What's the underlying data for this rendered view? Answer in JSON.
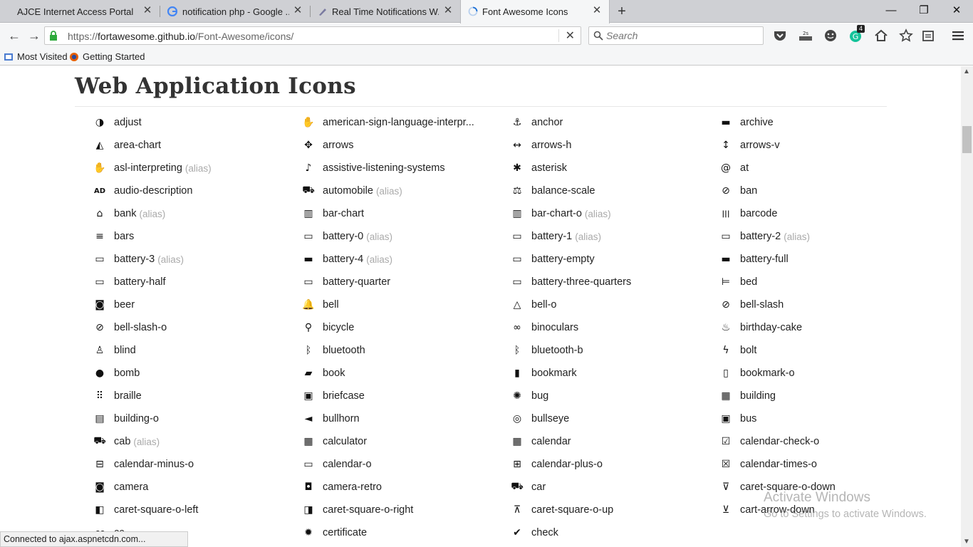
{
  "browser": {
    "tabs": [
      {
        "title": "AJCE Internet Access Portal",
        "active": false
      },
      {
        "title": "notification php - Google ...",
        "active": false
      },
      {
        "title": "Real Time Notifications W...",
        "active": false
      },
      {
        "title": "Font Awesome Icons",
        "active": true
      }
    ],
    "url_domain": "fortawesome.github.io",
    "url_prefix": "https://",
    "url_path": "/Font-Awesome/icons/",
    "search_placeholder": "Search",
    "bookmarks": [
      "Most Visited",
      "Getting Started"
    ],
    "badge_count": "4",
    "badge_small": "2s"
  },
  "page": {
    "title": "Web Application Icons",
    "alias_label": "(alias)",
    "icons": [
      {
        "name": "adjust",
        "glyph": "◑"
      },
      {
        "name": "american-sign-language-interpr...",
        "glyph": "✋"
      },
      {
        "name": "anchor",
        "glyph": "⚓"
      },
      {
        "name": "archive",
        "glyph": "▬"
      },
      {
        "name": "area-chart",
        "glyph": "◭"
      },
      {
        "name": "arrows",
        "glyph": "✥"
      },
      {
        "name": "arrows-h",
        "glyph": "↔"
      },
      {
        "name": "arrows-v",
        "glyph": "↕"
      },
      {
        "name": "asl-interpreting",
        "glyph": "✋",
        "alias": true
      },
      {
        "name": "assistive-listening-systems",
        "glyph": "♪"
      },
      {
        "name": "asterisk",
        "glyph": "✱"
      },
      {
        "name": "at",
        "glyph": "@"
      },
      {
        "name": "audio-description",
        "glyph": "AD"
      },
      {
        "name": "automobile",
        "glyph": "⛟",
        "alias": true
      },
      {
        "name": "balance-scale",
        "glyph": "⚖"
      },
      {
        "name": "ban",
        "glyph": "⊘"
      },
      {
        "name": "bank",
        "glyph": "⌂",
        "alias": true
      },
      {
        "name": "bar-chart",
        "glyph": "▥"
      },
      {
        "name": "bar-chart-o",
        "glyph": "▥",
        "alias": true
      },
      {
        "name": "barcode",
        "glyph": "|||"
      },
      {
        "name": "bars",
        "glyph": "≡"
      },
      {
        "name": "battery-0",
        "glyph": "▭",
        "alias": true
      },
      {
        "name": "battery-1",
        "glyph": "▭",
        "alias": true
      },
      {
        "name": "battery-2",
        "glyph": "▭",
        "alias": true
      },
      {
        "name": "battery-3",
        "glyph": "▭",
        "alias": true
      },
      {
        "name": "battery-4",
        "glyph": "▬",
        "alias": true
      },
      {
        "name": "battery-empty",
        "glyph": "▭"
      },
      {
        "name": "battery-full",
        "glyph": "▬"
      },
      {
        "name": "battery-half",
        "glyph": "▭"
      },
      {
        "name": "battery-quarter",
        "glyph": "▭"
      },
      {
        "name": "battery-three-quarters",
        "glyph": "▭"
      },
      {
        "name": "bed",
        "glyph": "⊨"
      },
      {
        "name": "beer",
        "glyph": "◙"
      },
      {
        "name": "bell",
        "glyph": "🔔"
      },
      {
        "name": "bell-o",
        "glyph": "△"
      },
      {
        "name": "bell-slash",
        "glyph": "⊘"
      },
      {
        "name": "bell-slash-o",
        "glyph": "⊘"
      },
      {
        "name": "bicycle",
        "glyph": "⚲"
      },
      {
        "name": "binoculars",
        "glyph": "∞"
      },
      {
        "name": "birthday-cake",
        "glyph": "♨"
      },
      {
        "name": "blind",
        "glyph": "♙"
      },
      {
        "name": "bluetooth",
        "glyph": "ᛒ"
      },
      {
        "name": "bluetooth-b",
        "glyph": "ᛒ"
      },
      {
        "name": "bolt",
        "glyph": "ϟ"
      },
      {
        "name": "bomb",
        "glyph": "●"
      },
      {
        "name": "book",
        "glyph": "▰"
      },
      {
        "name": "bookmark",
        "glyph": "▮"
      },
      {
        "name": "bookmark-o",
        "glyph": "▯"
      },
      {
        "name": "braille",
        "glyph": "⠿"
      },
      {
        "name": "briefcase",
        "glyph": "▣"
      },
      {
        "name": "bug",
        "glyph": "✺"
      },
      {
        "name": "building",
        "glyph": "▦"
      },
      {
        "name": "building-o",
        "glyph": "▤"
      },
      {
        "name": "bullhorn",
        "glyph": "◄"
      },
      {
        "name": "bullseye",
        "glyph": "◎"
      },
      {
        "name": "bus",
        "glyph": "▣"
      },
      {
        "name": "cab",
        "glyph": "⛟",
        "alias": true
      },
      {
        "name": "calculator",
        "glyph": "▦"
      },
      {
        "name": "calendar",
        "glyph": "▦"
      },
      {
        "name": "calendar-check-o",
        "glyph": "☑"
      },
      {
        "name": "calendar-minus-o",
        "glyph": "⊟"
      },
      {
        "name": "calendar-o",
        "glyph": "▭"
      },
      {
        "name": "calendar-plus-o",
        "glyph": "⊞"
      },
      {
        "name": "calendar-times-o",
        "glyph": "☒"
      },
      {
        "name": "camera",
        "glyph": "◙"
      },
      {
        "name": "camera-retro",
        "glyph": "◘"
      },
      {
        "name": "car",
        "glyph": "⛟"
      },
      {
        "name": "caret-square-o-down",
        "glyph": "⊽"
      },
      {
        "name": "caret-square-o-left",
        "glyph": "◧"
      },
      {
        "name": "caret-square-o-right",
        "glyph": "◨"
      },
      {
        "name": "caret-square-o-up",
        "glyph": "⊼"
      },
      {
        "name": "cart-arrow-down",
        "glyph": "⊻"
      },
      {
        "name": "cc",
        "glyph": "㏄"
      },
      {
        "name": "certificate",
        "glyph": "✹"
      },
      {
        "name": "check",
        "glyph": "✔"
      }
    ]
  },
  "status": {
    "text": "Connected to ajax.aspnetcdn.com...",
    "watermark_title": "Activate Windows",
    "watermark_sub": "Go to Settings to activate Windows."
  }
}
